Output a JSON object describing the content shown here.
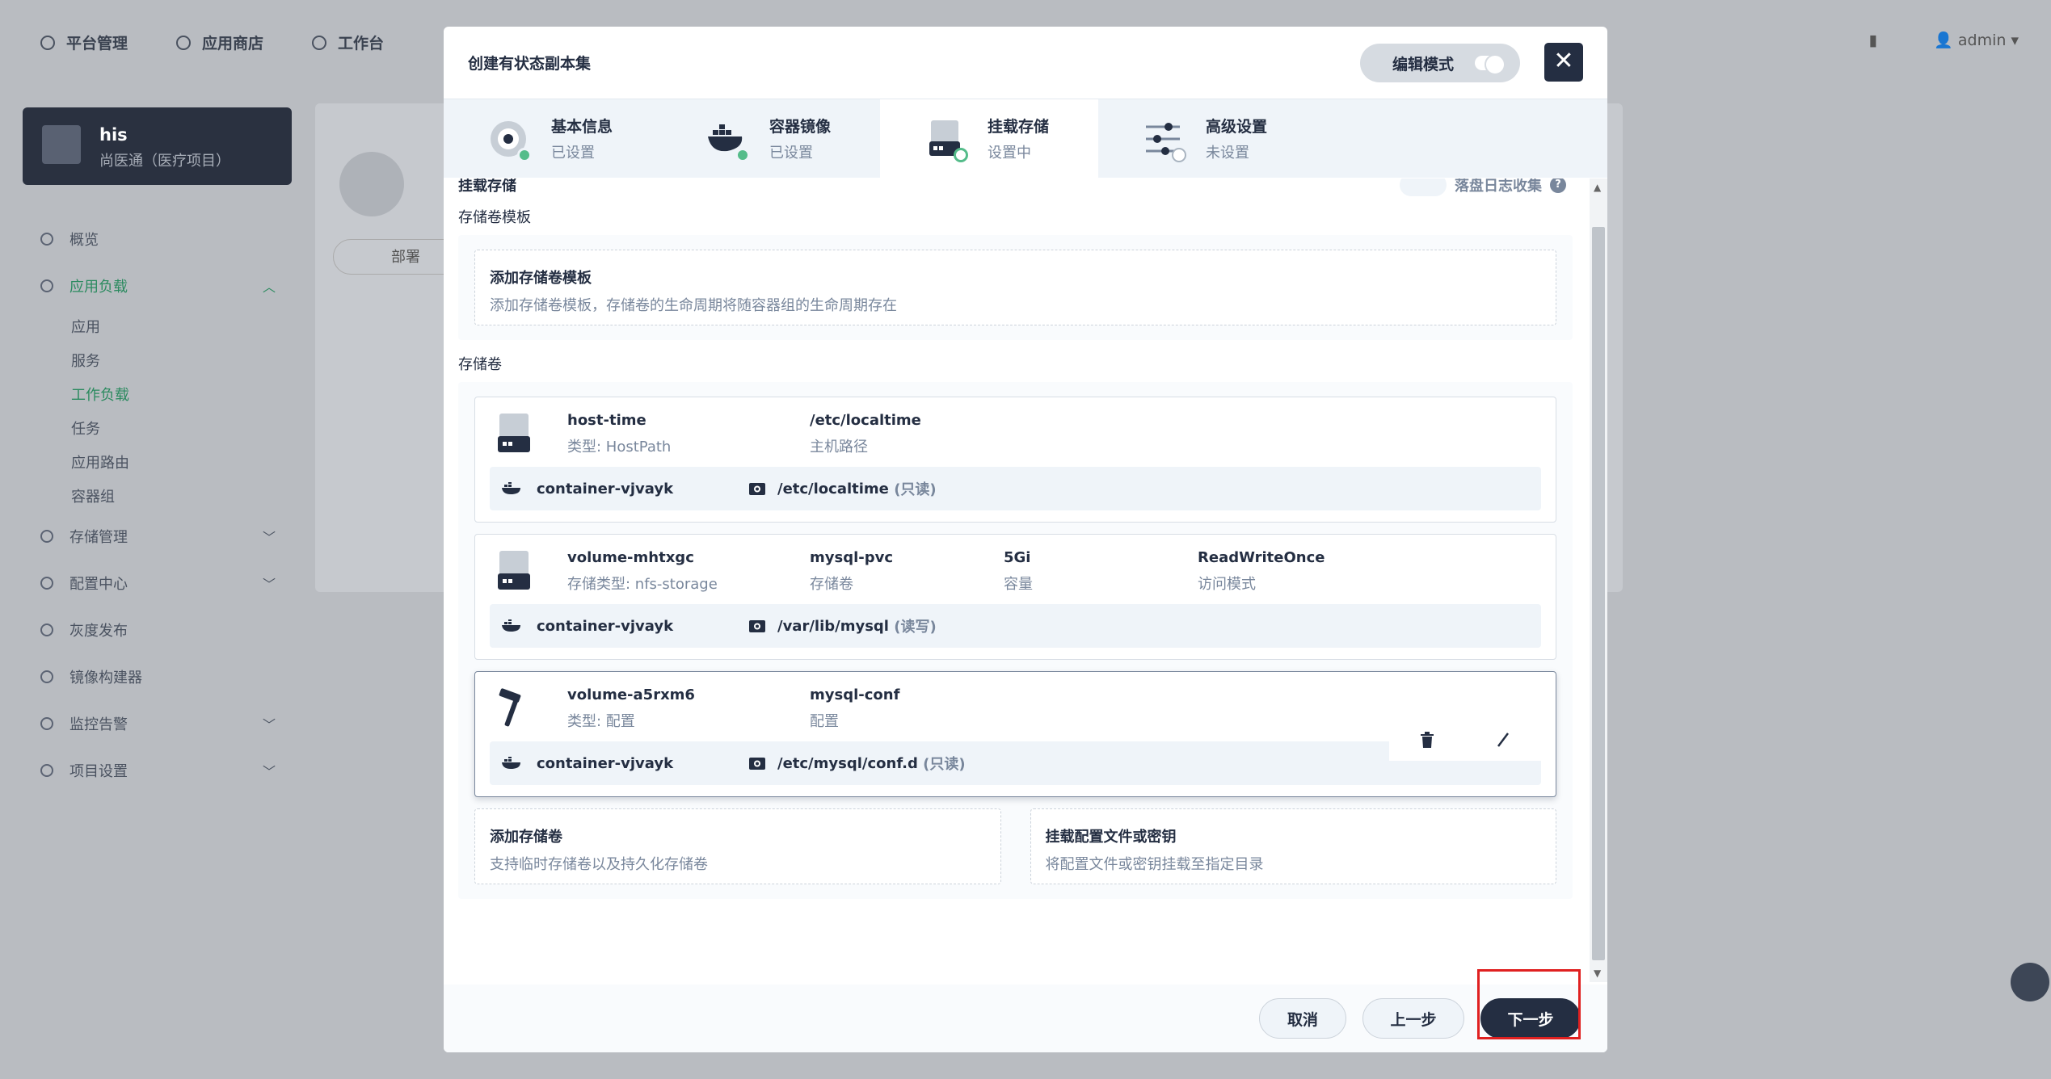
{
  "topbar": {
    "nav": [
      "平台管理",
      "应用商店",
      "工作台"
    ],
    "user": "admin"
  },
  "sidebar": {
    "project_name": "his",
    "project_desc": "尚医通（医疗项目）",
    "items": [
      {
        "label": "概览"
      },
      {
        "label": "应用负载"
      },
      {
        "label": "存储管理"
      },
      {
        "label": "配置中心"
      },
      {
        "label": "灰度发布"
      },
      {
        "label": "镜像构建器"
      },
      {
        "label": "监控告警"
      },
      {
        "label": "项目设置"
      }
    ],
    "sub_items": [
      "应用",
      "服务",
      "工作负载",
      "任务",
      "应用路由",
      "容器组"
    ]
  },
  "background": {
    "tab_label": "部署"
  },
  "modal": {
    "title": "创建有状态副本集",
    "edit_mode": "编辑模式",
    "steps": [
      {
        "title": "基本信息",
        "status": "已设置"
      },
      {
        "title": "容器镜像",
        "status": "已设置"
      },
      {
        "title": "挂载存储",
        "status": "设置中"
      },
      {
        "title": "高级设置",
        "status": "未设置"
      }
    ],
    "section_title": "挂载存储",
    "log_collect": "落盘日志收集",
    "template_label": "存储卷模板",
    "template_add_title": "添加存储卷模板",
    "template_add_desc": "添加存储卷模板，存储卷的生命周期将随容器组的生命周期存在",
    "volumes_label": "存储卷",
    "volumes": [
      {
        "icon": "disk-icon",
        "name": "host-time",
        "type": "类型: HostPath",
        "c2a": "/etc/localtime",
        "c2b": "主机路径",
        "container": "container-vjvayk",
        "mount_path": "/etc/localtime",
        "mode": "(只读)"
      },
      {
        "icon": "disk-icon",
        "name": "volume-mhtxgc",
        "type": "存储类型: nfs-storage",
        "c2a": "mysql-pvc",
        "c2b": "存储卷",
        "c3a": "5Gi",
        "c3b": "容量",
        "c4a": "ReadWriteOnce",
        "c4b": "访问模式",
        "container": "container-vjvayk",
        "mount_path": "/var/lib/mysql",
        "mode": "(读写)"
      },
      {
        "icon": "hammer-icon",
        "name": "volume-a5rxm6",
        "type": "类型: 配置",
        "c2a": "mysql-conf",
        "c2b": "配置",
        "container": "container-vjvayk",
        "mount_path": "/etc/mysql/conf.d",
        "mode": "(只读)"
      }
    ],
    "add_volume_title": "添加存储卷",
    "add_volume_desc": "支持临时存储卷以及持久化存储卷",
    "mount_config_title": "挂载配置文件或密钥",
    "mount_config_desc": "将配置文件或密钥挂载至指定目录",
    "cancel": "取消",
    "prev": "上一步",
    "next": "下一步"
  },
  "colors": {
    "accent": "#55bc8a",
    "dark": "#242e42",
    "highlight": "#e02020"
  }
}
